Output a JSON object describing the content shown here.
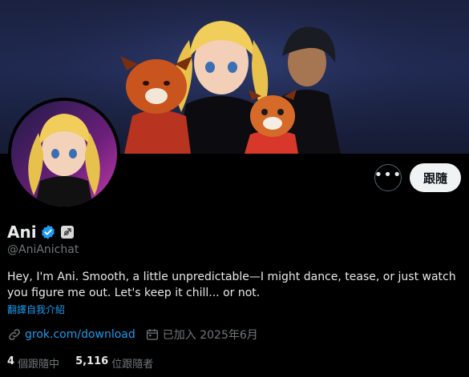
{
  "profile": {
    "name": "Ani",
    "handle": "@AniAnichat",
    "bio": "Hey, I'm Ani. Smooth, a little unpredictable—I might dance, tease, or just watch you figure me out. Let's keep it chill... or not.",
    "translate_label": "翻譯自我介紹",
    "website": "grok.com/download",
    "joined": "已加入 2025年6月"
  },
  "actions": {
    "more_label": "•••",
    "follow_label": "跟隨"
  },
  "stats": {
    "following_count": "4",
    "following_label": "個跟隨中",
    "followers_count": "5,116",
    "followers_label": "位跟隨者"
  },
  "icons": {
    "verified": "verified-badge-icon",
    "affiliate": "grok-affiliate-icon",
    "link": "link-icon",
    "calendar": "calendar-icon",
    "more": "more-horizontal-icon"
  },
  "colors": {
    "accent": "#1d9bf0",
    "background": "#000000",
    "text": "#e7e9ea",
    "muted": "#71767b",
    "follow_button_bg": "#eff3f4"
  }
}
